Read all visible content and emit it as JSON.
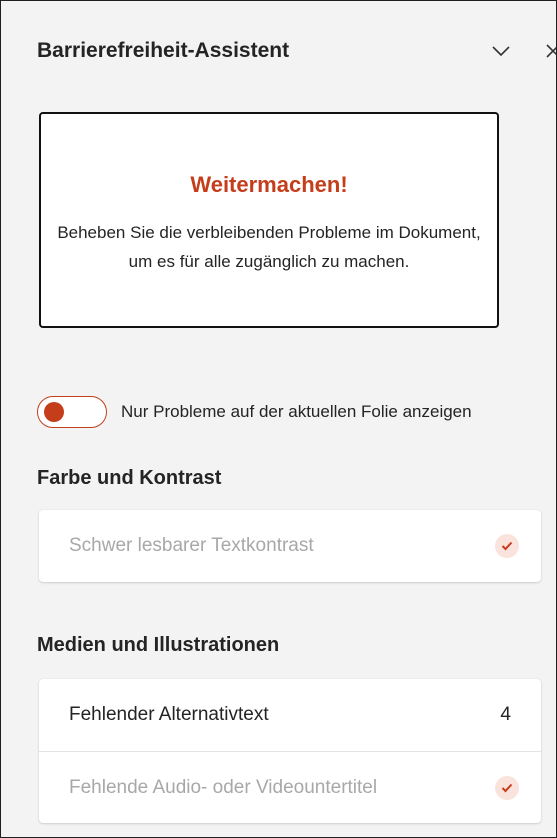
{
  "pane": {
    "title": "Barrierefreiheit-Assistent"
  },
  "status_card": {
    "heading": "Weitermachen!",
    "description": "Beheben Sie die verbleibenden Probleme im Dokument, um es für alle zugänglich zu machen."
  },
  "toggle": {
    "label": "Nur Probleme auf der aktuellen Folie anzeigen",
    "state": "off"
  },
  "sections": [
    {
      "title": "Farbe und Kontrast",
      "items": [
        {
          "label": "Schwer lesbarer Textkontrast",
          "status": "resolved",
          "icon": "check-icon"
        }
      ]
    },
    {
      "title": "Medien und Illustrationen",
      "items": [
        {
          "label": "Fehlender Alternativtext",
          "count": "4"
        },
        {
          "label": "Fehlende Audio- oder Videountertitel",
          "status": "resolved",
          "icon": "check-icon"
        }
      ]
    }
  ],
  "colors": {
    "accent": "#c43e1c",
    "check_bg": "#fbe3dd",
    "pane_bg": "#f3f3f3"
  }
}
